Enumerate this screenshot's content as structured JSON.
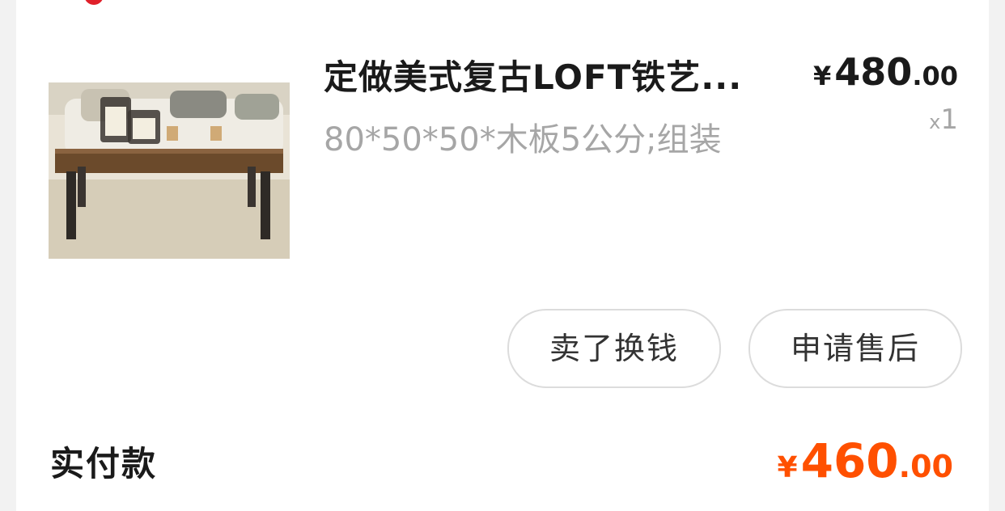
{
  "item": {
    "title": "定做美式复古LOFT铁艺...",
    "spec": "80*50*50*木板5公分;组装",
    "price": {
      "symbol": "¥",
      "integer": "480",
      "decimal": ".00"
    },
    "quantity": {
      "prefix": "x",
      "value": "1"
    },
    "image_alt": "rustic wooden coffee table with iron legs"
  },
  "actions": {
    "sell_label": "卖了换钱",
    "after_sale_label": "申请售后"
  },
  "payment": {
    "label": "实付款",
    "amount": {
      "symbol": "¥",
      "integer": "460",
      "decimal": ".00"
    }
  },
  "colors": {
    "accent": "#ff5000",
    "badge": "#e0202a",
    "text": "#1a1a1a",
    "muted": "#a6a6a6"
  }
}
